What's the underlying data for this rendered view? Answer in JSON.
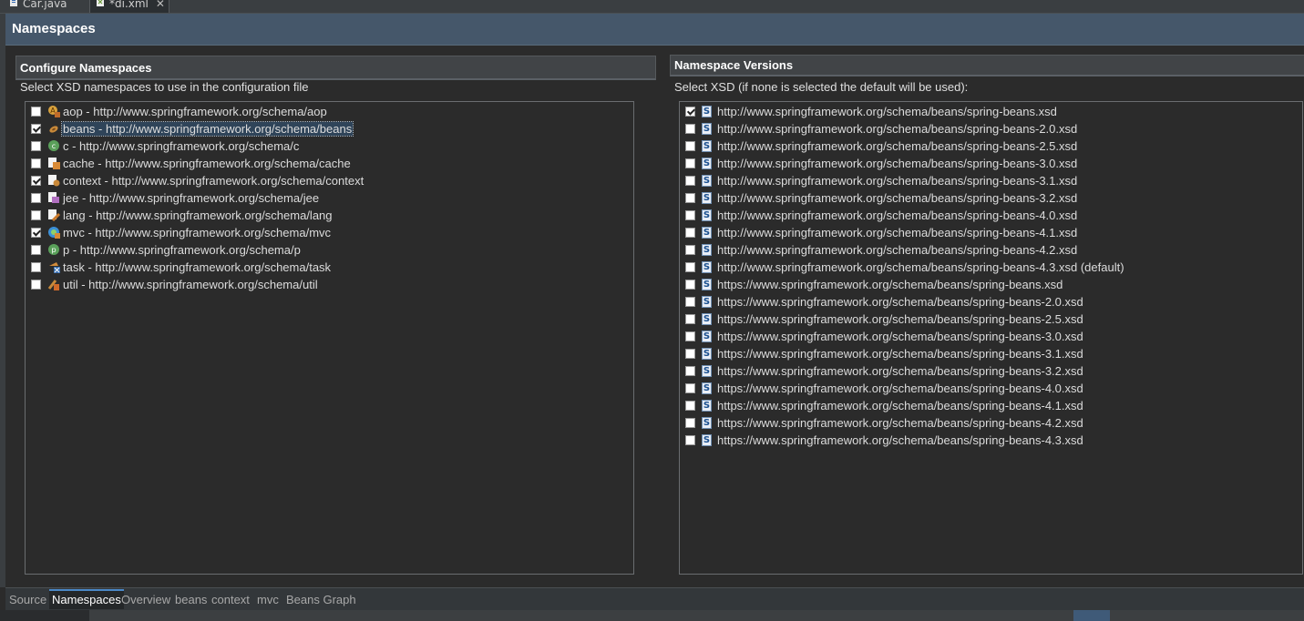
{
  "editor_tabs": [
    {
      "label": "Car.java",
      "icon": "java-file-icon"
    },
    {
      "label": "*di.xml",
      "icon": "spring-xml-icon",
      "close": "✕"
    }
  ],
  "header": {
    "title": "Namespaces"
  },
  "left_section": {
    "title": "Configure Namespaces",
    "description": "Select XSD namespaces to use in the configuration file",
    "items": [
      {
        "label": "aop - http://www.springframework.org/schema/aop",
        "checked": false,
        "icon": "aop-icon"
      },
      {
        "label": "beans - http://www.springframework.org/schema/beans",
        "checked": true,
        "icon": "beans-icon",
        "selected": true
      },
      {
        "label": "c - http://www.springframework.org/schema/c",
        "checked": false,
        "icon": "c-namespace-icon"
      },
      {
        "label": "cache - http://www.springframework.org/schema/cache",
        "checked": false,
        "icon": "cache-icon"
      },
      {
        "label": "context - http://www.springframework.org/schema/context",
        "checked": true,
        "icon": "context-icon"
      },
      {
        "label": "jee - http://www.springframework.org/schema/jee",
        "checked": false,
        "icon": "jee-icon"
      },
      {
        "label": "lang - http://www.springframework.org/schema/lang",
        "checked": false,
        "icon": "lang-icon"
      },
      {
        "label": "mvc - http://www.springframework.org/schema/mvc",
        "checked": true,
        "icon": "mvc-icon"
      },
      {
        "label": "p - http://www.springframework.org/schema/p",
        "checked": false,
        "icon": "p-namespace-icon"
      },
      {
        "label": "task - http://www.springframework.org/schema/task",
        "checked": false,
        "icon": "task-icon"
      },
      {
        "label": "util - http://www.springframework.org/schema/util",
        "checked": false,
        "icon": "util-icon"
      }
    ]
  },
  "right_section": {
    "title": "Namespace Versions",
    "description": "Select XSD (if none is selected the default will be used):",
    "items": [
      {
        "label": "http://www.springframework.org/schema/beans/spring-beans.xsd",
        "checked": true
      },
      {
        "label": "http://www.springframework.org/schema/beans/spring-beans-2.0.xsd",
        "checked": false
      },
      {
        "label": "http://www.springframework.org/schema/beans/spring-beans-2.5.xsd",
        "checked": false
      },
      {
        "label": "http://www.springframework.org/schema/beans/spring-beans-3.0.xsd",
        "checked": false
      },
      {
        "label": "http://www.springframework.org/schema/beans/spring-beans-3.1.xsd",
        "checked": false
      },
      {
        "label": "http://www.springframework.org/schema/beans/spring-beans-3.2.xsd",
        "checked": false
      },
      {
        "label": "http://www.springframework.org/schema/beans/spring-beans-4.0.xsd",
        "checked": false
      },
      {
        "label": "http://www.springframework.org/schema/beans/spring-beans-4.1.xsd",
        "checked": false
      },
      {
        "label": "http://www.springframework.org/schema/beans/spring-beans-4.2.xsd",
        "checked": false
      },
      {
        "label": "http://www.springframework.org/schema/beans/spring-beans-4.3.xsd (default)",
        "checked": false
      },
      {
        "label": "https://www.springframework.org/schema/beans/spring-beans.xsd",
        "checked": false
      },
      {
        "label": "https://www.springframework.org/schema/beans/spring-beans-2.0.xsd",
        "checked": false
      },
      {
        "label": "https://www.springframework.org/schema/beans/spring-beans-2.5.xsd",
        "checked": false
      },
      {
        "label": "https://www.springframework.org/schema/beans/spring-beans-3.0.xsd",
        "checked": false
      },
      {
        "label": "https://www.springframework.org/schema/beans/spring-beans-3.1.xsd",
        "checked": false
      },
      {
        "label": "https://www.springframework.org/schema/beans/spring-beans-3.2.xsd",
        "checked": false
      },
      {
        "label": "https://www.springframework.org/schema/beans/spring-beans-4.0.xsd",
        "checked": false
      },
      {
        "label": "https://www.springframework.org/schema/beans/spring-beans-4.1.xsd",
        "checked": false
      },
      {
        "label": "https://www.springframework.org/schema/beans/spring-beans-4.2.xsd",
        "checked": false
      },
      {
        "label": "https://www.springframework.org/schema/beans/spring-beans-4.3.xsd",
        "checked": false
      }
    ],
    "item_icon": "xsd-file-icon",
    "item_icon_glyph": "S"
  },
  "bottom_tabs": [
    {
      "label": "Source",
      "active": false
    },
    {
      "label": "Namespaces",
      "active": true
    },
    {
      "label": "Overview",
      "active": false
    },
    {
      "label": "beans",
      "active": false
    },
    {
      "label": "context",
      "active": false
    },
    {
      "label": "mvc",
      "active": false
    },
    {
      "label": "Beans Graph",
      "active": false
    }
  ],
  "colors": {
    "background": "#2b2b2b",
    "header": "#45576a",
    "selection": "#2f4459",
    "active_tab_accent": "#4a88c7"
  }
}
